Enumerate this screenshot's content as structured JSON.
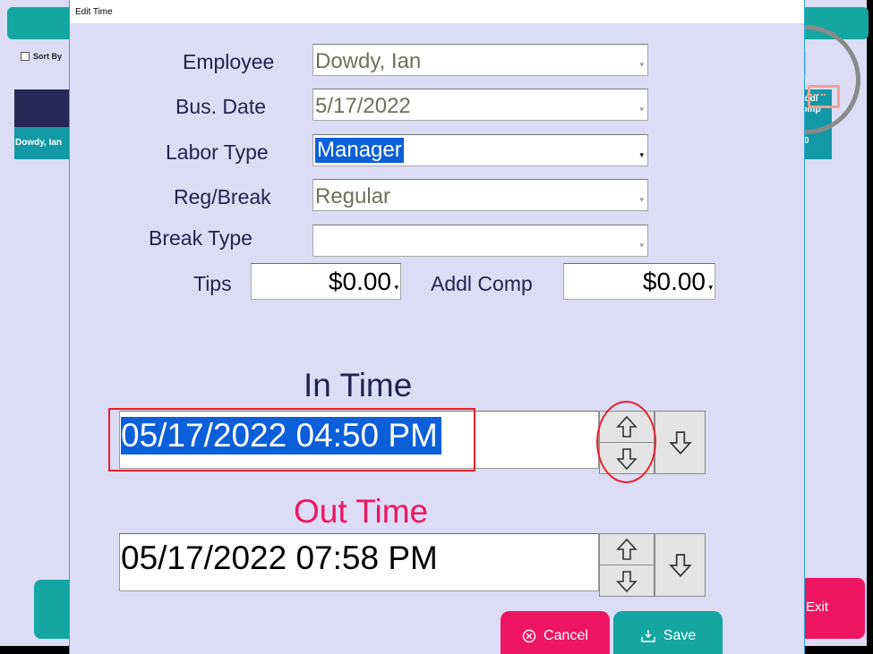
{
  "background": {
    "sort_label": "Sort By",
    "employee_tile": "Dowdy, Ian",
    "right_tile_label": "ddl\nomp",
    "right_tile_value": "0",
    "exit_label": "Exit"
  },
  "dialog": {
    "title": "Edit Time",
    "fields": {
      "employee": {
        "label": "Employee",
        "value": "Dowdy, Ian"
      },
      "bus_date": {
        "label": "Bus. Date",
        "value": "5/17/2022"
      },
      "labor_type": {
        "label": "Labor Type",
        "value": "Manager"
      },
      "reg_break": {
        "label": "Reg/Break",
        "value": "Regular"
      },
      "break_type": {
        "label": "Break Type",
        "value": ""
      },
      "tips": {
        "label": "Tips",
        "value": "$0.00"
      },
      "addl_comp": {
        "label": "Addl Comp",
        "value": "$0.00"
      }
    },
    "in_time": {
      "heading": "In Time",
      "value": "05/17/2022 04:50 PM"
    },
    "out_time": {
      "heading": "Out Time",
      "value": "05/17/2022 07:58 PM"
    },
    "buttons": {
      "cancel": "Cancel",
      "save": "Save"
    }
  },
  "colors": {
    "dialog_bg": "#dcdcf5",
    "teal": "#14a6a0",
    "pink": "#ee1660",
    "selection": "#0b5fd9",
    "annotation": "#e8202a",
    "in_time_heading": "#232350",
    "out_time_heading": "#ee1660"
  }
}
